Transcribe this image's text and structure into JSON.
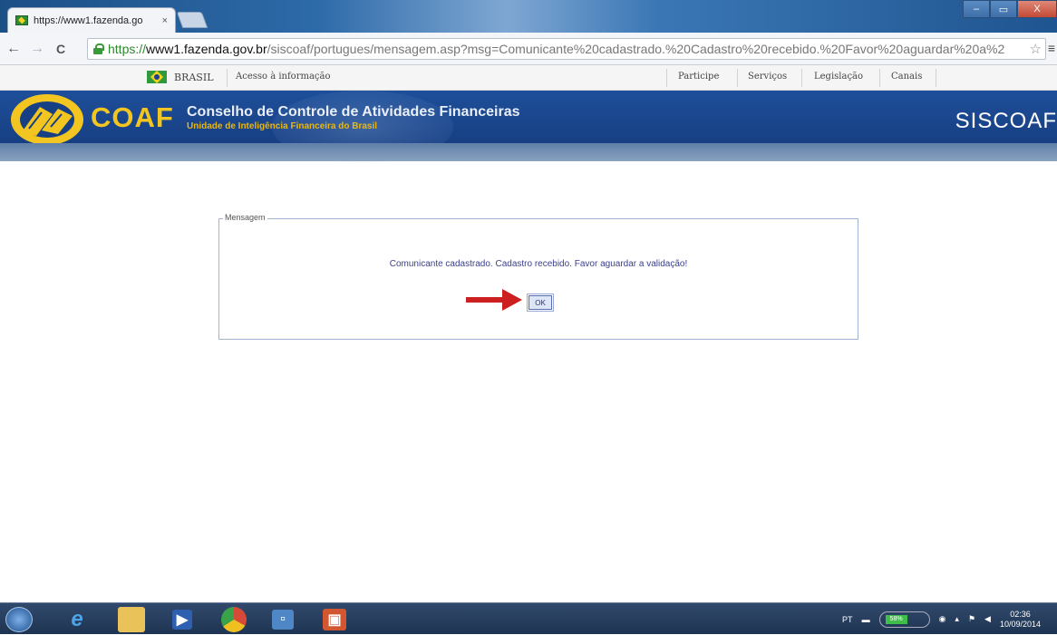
{
  "browser": {
    "tab_title": "https://www1.fazenda.go",
    "tab_close": "×",
    "window_controls": {
      "minimize": "–",
      "maximize": "▭",
      "close": "X"
    },
    "nav": {
      "back": "←",
      "forward": "→",
      "reload": "C"
    },
    "url_scheme": "https://",
    "url_host": "www1.fazenda.gov.br",
    "url_path": "/siscoaf/portugues/mensagem.asp?msg=Comunicante%20cadastrado.%20Cadastro%20recebido.%20Favor%20aguardar%20a%2",
    "bookmark_icon": "star-icon",
    "menu_icon": "≡"
  },
  "govbar": {
    "country": "BRASIL",
    "access_info": "Acesso à informação",
    "links": [
      "Participe",
      "Serviços",
      "Legislação",
      "Canais"
    ]
  },
  "header": {
    "logo_text": "COAF",
    "org_name": "Conselho de Controle de Atividades Financeiras",
    "org_subtitle": "Unidade de Inteligência Financeira do Brasil",
    "system_name": "SISCOAF"
  },
  "message_box": {
    "legend": "Mensagem",
    "text": "Comunicante cadastrado. Cadastro recebido. Favor aguardar a validação!",
    "ok_label": "OK"
  },
  "annotation": {
    "arrow_color": "#cc1f1f"
  },
  "taskbar": {
    "apps": [
      "start-orb-icon",
      "internet-explorer-icon",
      "file-explorer-icon",
      "media-player-icon",
      "chrome-icon",
      "remote-desktop-icon",
      "office-icon"
    ],
    "language": "PT",
    "battery": "58%",
    "time": "02:36",
    "date": "10/09/2014"
  },
  "colors": {
    "header_blue": "#1e4f9a",
    "coaf_gold": "#f2c521",
    "message_text": "#3a3f8c"
  }
}
